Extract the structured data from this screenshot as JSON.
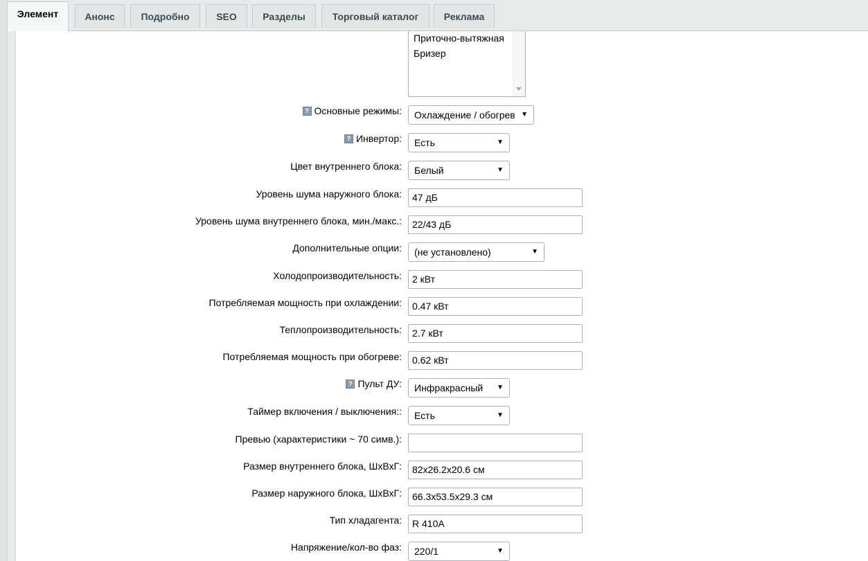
{
  "tabs": [
    {
      "label": "Элемент",
      "active": true
    },
    {
      "label": "Анонс"
    },
    {
      "label": "Подробно"
    },
    {
      "label": "SEO"
    },
    {
      "label": "Разделы"
    },
    {
      "label": "Торговый каталог"
    },
    {
      "label": "Реклама"
    }
  ],
  "listbox": {
    "options": [
      "Приточно-вытяжная",
      "Бризер"
    ]
  },
  "fields": {
    "modes": {
      "label": "Основные режимы:",
      "value": "Охлаждение / обогрев",
      "help": "?"
    },
    "inverter": {
      "label": "Инвертор:",
      "value": "Есть",
      "help": "?"
    },
    "indoor_color": {
      "label": "Цвет внутреннего блока:",
      "value": "Белый"
    },
    "outdoor_noise": {
      "label": "Уровень шума наружного блока:",
      "value": "47 дБ"
    },
    "indoor_noise": {
      "label": "Уровень шума внутреннего блока, мин./макс.:",
      "value": "22/43 дБ"
    },
    "extra_options": {
      "label": "Дополнительные опции:",
      "value": "(не установлено)"
    },
    "cooling_capacity": {
      "label": "Холодопроизводительность:",
      "value": "2 кВт"
    },
    "cooling_power": {
      "label": "Потребляемая мощность при охлаждении:",
      "value": "0.47 кВт"
    },
    "heating_capacity": {
      "label": "Теплопроизводительность:",
      "value": "2.7 кВт"
    },
    "heating_power": {
      "label": "Потребляемая мощность при обогреве:",
      "value": "0.62 кВт"
    },
    "remote": {
      "label": "Пульт ДУ:",
      "value": "Инфракрасный",
      "help": "?"
    },
    "timer": {
      "label": "Таймер включения / выключения::",
      "value": "Есть"
    },
    "preview": {
      "label": "Превью (характеристики ~ 70 симв.):",
      "value": ""
    },
    "indoor_size": {
      "label": "Размер внутреннего блока, ШхВхГ:",
      "value": "82x26.2x20.6 см"
    },
    "outdoor_size": {
      "label": "Размер наружного блока, ШхВхГ:",
      "value": "66.3x53.5x29.3 см"
    },
    "refrigerant": {
      "label": "Тип хладагента:",
      "value": "R 410A"
    },
    "voltage": {
      "label": "Напряжение/кол-во фаз:",
      "value": "220/1"
    }
  },
  "icons": {
    "select_arrow": "▼",
    "help": "help-icon"
  }
}
